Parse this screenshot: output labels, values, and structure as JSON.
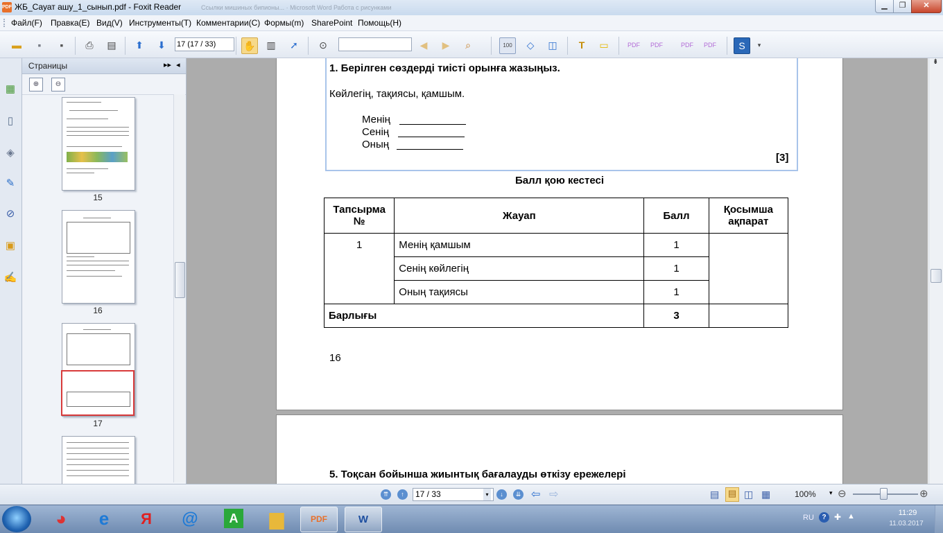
{
  "window": {
    "title": "ЖБ_Сауат ашу_1_сынып.pdf - Foxit Reader",
    "background_titles": "Ссылки мишиных бипионы... · Microsoft Word        Работа с рисунками"
  },
  "menu": [
    "Файл(F)",
    "Правка(E)",
    "Вид(V)",
    "Инструменты(T)",
    "Комментарии(C)",
    "Формы(m)",
    "SharePoint",
    "Помощь(H)"
  ],
  "toolbar": {
    "page_field": "17 (17 / 33)",
    "search_value": ""
  },
  "panel": {
    "title": "Страницы",
    "thumbnails": [
      {
        "label": "15"
      },
      {
        "label": "16"
      },
      {
        "label": "17"
      }
    ]
  },
  "document": {
    "task_heading": "1. Берілген сөздерді  тиісті орынға жазыңыз.",
    "word_list": "Көйлегің, тақиясы, қамшым.",
    "fill_lines": [
      "Менің",
      "Сенің",
      "Оның"
    ],
    "points": "[3]",
    "table_title": "Балл қою кестесі",
    "table": {
      "headers": [
        "Тапсырма №",
        "Жауап",
        "Балл",
        "Қосымша ақпарат"
      ],
      "task_number": "1",
      "rows": [
        {
          "answer": "Менің қамшым",
          "score": "1"
        },
        {
          "answer": "Сенің көйлегің",
          "score": "1"
        },
        {
          "answer": "Оның тақиясы",
          "score": "1"
        }
      ],
      "total_label": "Барлығы",
      "total_score": "3"
    },
    "page_number": "16",
    "next_heading": "5. Тоқсан бойынша жиынтық бағалауды өткізу ережелері"
  },
  "status": {
    "page_field": "17 / 33",
    "zoom": "100%"
  },
  "tray": {
    "lang": "RU",
    "help": "?",
    "time": "11:29",
    "date": "11.03.2017"
  },
  "taskbar_apps": [
    "chrome",
    "internet-explorer",
    "yandex",
    "mail-agent",
    "a-app",
    "explorer",
    "foxit-reader",
    "word"
  ]
}
